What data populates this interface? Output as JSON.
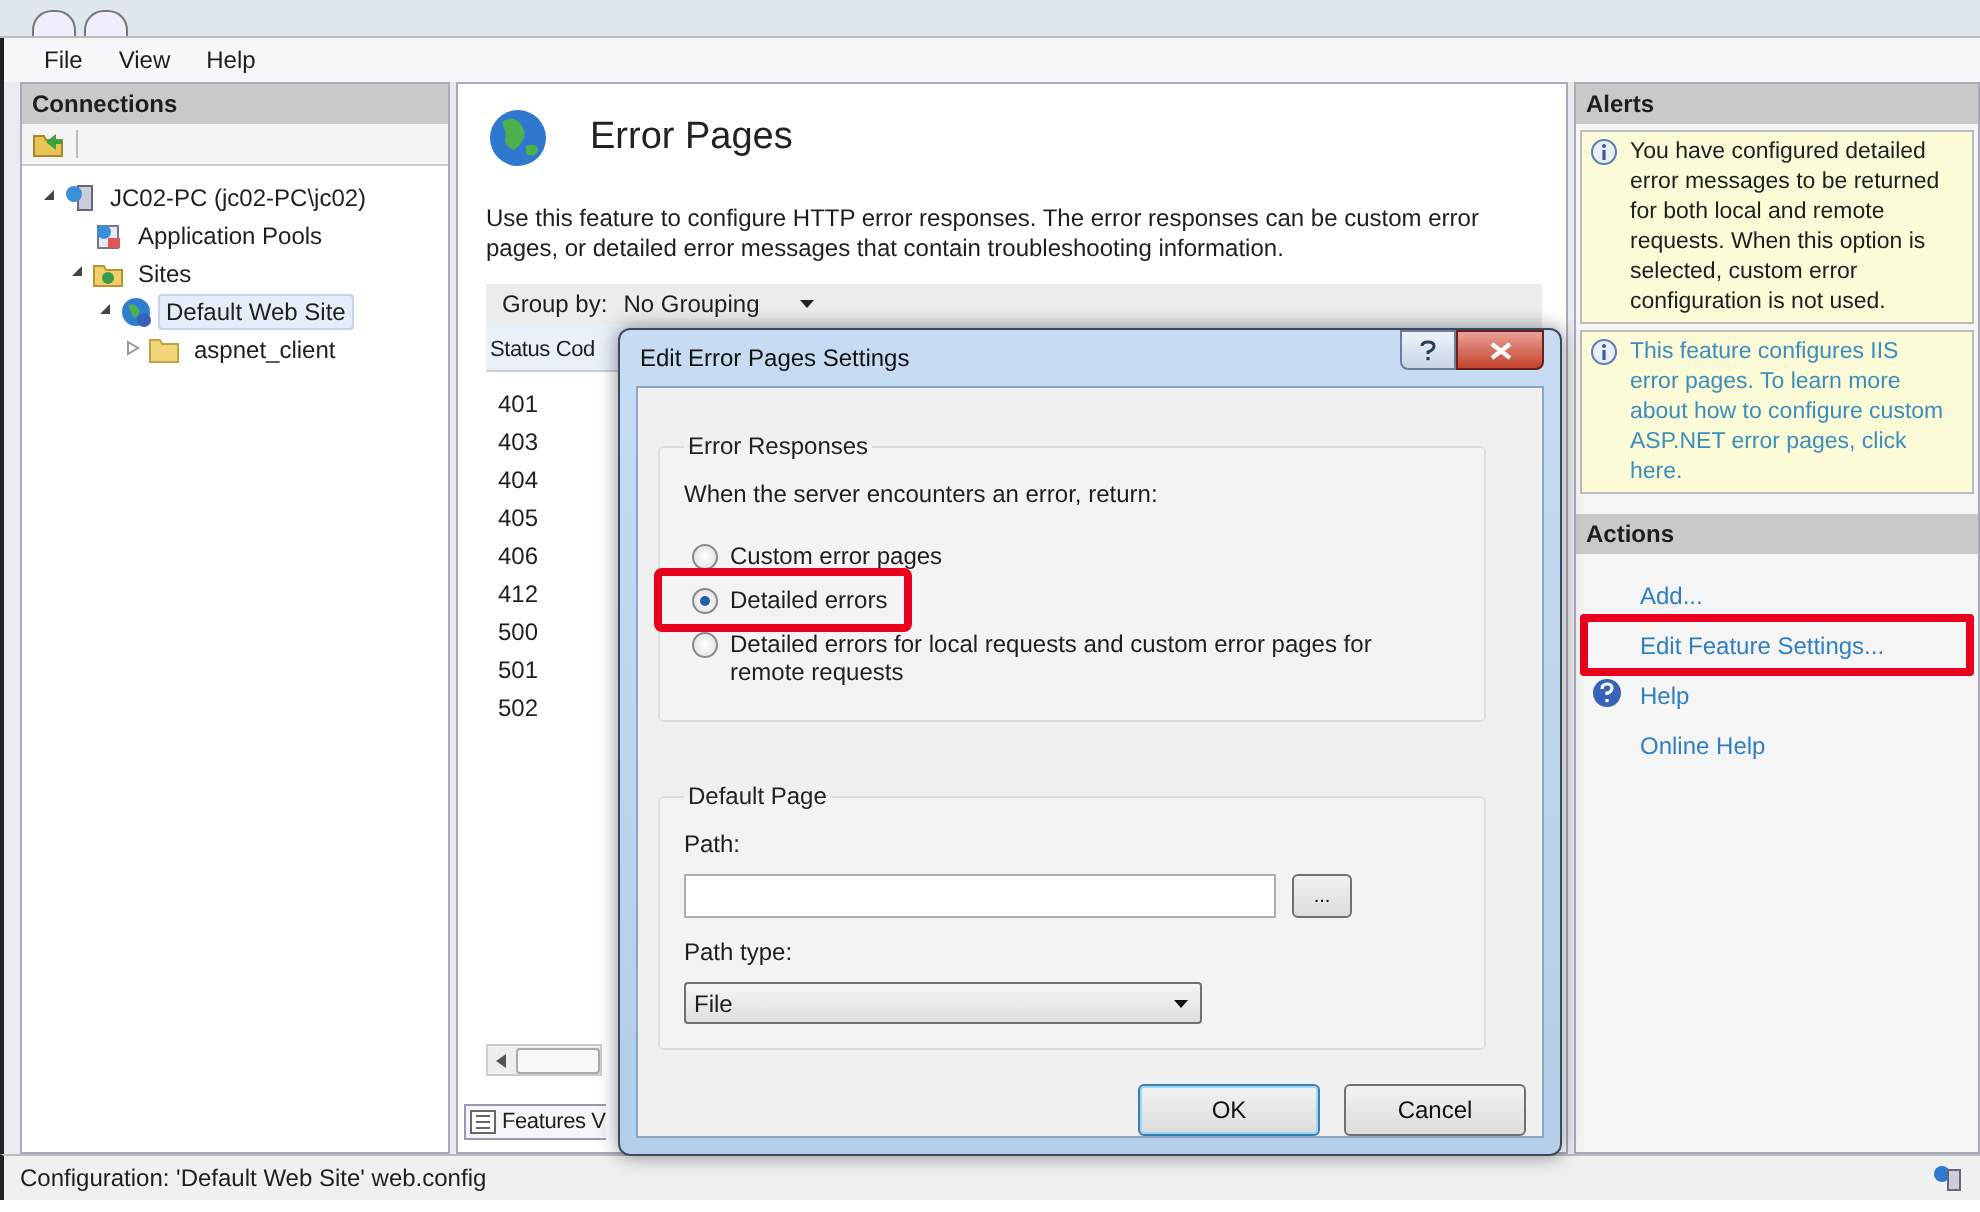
{
  "menu": [
    "File",
    "View",
    "Help"
  ],
  "connections": {
    "title": "Connections",
    "tree": [
      {
        "label": "JC02-PC (jc02-PC\\jc02)",
        "kind": "server",
        "expanded": true,
        "selected": false,
        "children": [
          {
            "label": "Application Pools",
            "kind": "pool",
            "selected": false
          },
          {
            "label": "Sites",
            "kind": "sites",
            "expanded": true,
            "selected": false,
            "children": [
              {
                "label": "Default Web Site",
                "kind": "site",
                "expanded": true,
                "selected": true,
                "children": [
                  {
                    "label": "aspnet_client",
                    "kind": "folder",
                    "expanded": false,
                    "selected": false
                  }
                ]
              }
            ]
          }
        ]
      }
    ]
  },
  "feature": {
    "title": "Error Pages",
    "description": "Use this feature to configure HTTP error responses. The error responses can be custom error pages, or detailed error messages that contain troubleshooting information.",
    "group_by_label": "Group by:",
    "group_by_value": "No Grouping",
    "columns": [
      "Status Cod"
    ],
    "rows": [
      "401",
      "403",
      "404",
      "405",
      "406",
      "412",
      "500",
      "501",
      "502"
    ],
    "view_tab": "Features V"
  },
  "dialog": {
    "title": "Edit Error Pages Settings",
    "group1_title": "Error Responses",
    "prompt": "When the server encounters an error, return:",
    "options": [
      {
        "label": "Custom error pages",
        "selected": false,
        "highlighted": false
      },
      {
        "label": "Detailed errors",
        "selected": true,
        "highlighted": true
      },
      {
        "label": "Detailed errors for local requests and custom error pages for remote requests",
        "selected": false,
        "highlighted": false
      }
    ],
    "group2_title": "Default Page",
    "path_label": "Path:",
    "browse_button": "...",
    "path_type_label": "Path type:",
    "path_type_value": "File",
    "ok": "OK",
    "cancel": "Cancel"
  },
  "alerts": {
    "title": "Alerts",
    "items": [
      {
        "kind": "text",
        "text": "You have configured detailed error messages to be returned for both local and remote requests. When this option is selected, custom error configuration is not used."
      },
      {
        "kind": "link",
        "text": "This feature configures IIS error pages. To learn more about how to configure custom ASP.NET error pages, click here."
      }
    ]
  },
  "actions": {
    "title": "Actions",
    "items": [
      {
        "label": "Add...",
        "kind": "plain",
        "highlighted": false
      },
      {
        "label": "Edit Feature Settings...",
        "kind": "plain",
        "highlighted": true
      },
      {
        "label": "Help",
        "kind": "help",
        "highlighted": false
      },
      {
        "label": "Online Help",
        "kind": "plain",
        "highlighted": false
      }
    ]
  },
  "status_bar": "Configuration: 'Default Web Site' web.config"
}
